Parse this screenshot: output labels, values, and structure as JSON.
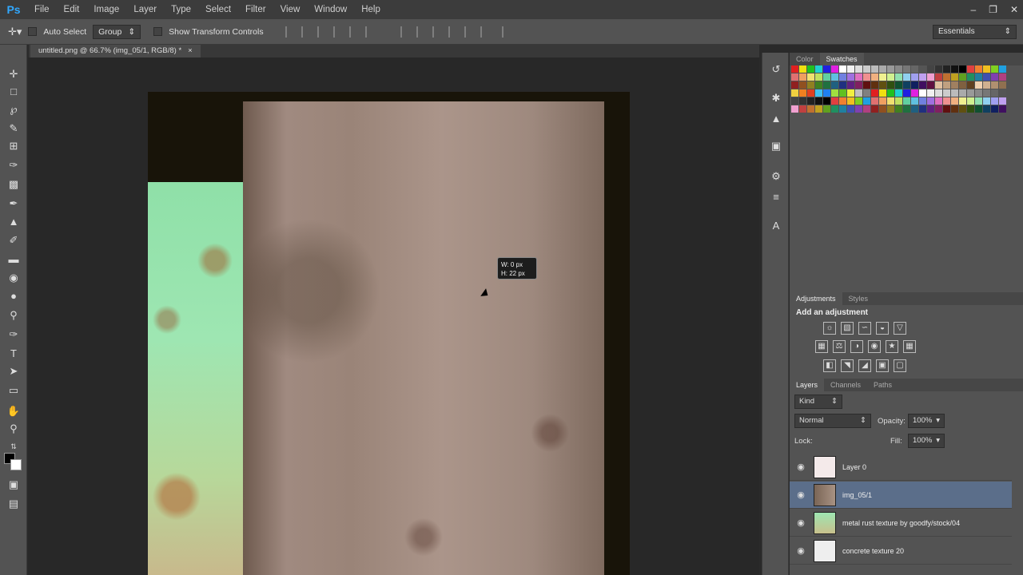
{
  "app": {
    "logo": "Ps"
  },
  "menu": [
    "File",
    "Edit",
    "Image",
    "Layer",
    "Type",
    "Select",
    "Filter",
    "View",
    "Window",
    "Help"
  ],
  "window_controls": [
    "minimize-icon",
    "restore-icon",
    "close-icon"
  ],
  "options": {
    "tool_icon": "move-tool-icon",
    "auto_select_label": "Auto Select",
    "auto_select_value": "Group",
    "show_transform_label": "Show Transform Controls",
    "workspace": "Essentials"
  },
  "document": {
    "tab_title": "untitled.png @ 66.7% (img_05/1, RGB/8) *",
    "tooltip_line1": "W: 0 px",
    "tooltip_line2": "H: 22 px"
  },
  "tools": [
    "move-tool-icon",
    "marquee-tool-icon",
    "lasso-tool-icon",
    "quick-select-tool-icon",
    "crop-tool-icon",
    "eyedropper-tool-icon",
    "healing-brush-icon",
    "brush-tool-icon",
    "clone-stamp-icon",
    "history-brush-icon",
    "eraser-tool-icon",
    "gradient-tool-icon",
    "blur-tool-icon",
    "dodge-tool-icon",
    "pen-tool-icon",
    "type-tool-icon",
    "path-select-tool-icon",
    "rectangle-tool-icon",
    "hand-tool-icon",
    "zoom-tool-icon"
  ],
  "strip_icons": [
    "history-icon",
    "brush-presets-icon",
    "clone-source-icon",
    "tool-presets-icon",
    "properties-icon",
    "character-icon"
  ],
  "swatches_panel": {
    "tabs": [
      "Color",
      "Swatches"
    ],
    "active": "Swatches"
  },
  "adjustments_panel": {
    "tabs": [
      "Adjustments",
      "Styles"
    ],
    "title": "Add an adjustment"
  },
  "layers_panel": {
    "tabs": [
      "Layers",
      "Channels",
      "Paths"
    ],
    "kind_filter": "Kind",
    "blend_mode": "Normal",
    "opacity_label": "Opacity:",
    "opacity_value": "100%",
    "lock_label": "Lock:",
    "fill_label": "Fill:",
    "fill_value": "100%",
    "layers": [
      {
        "name": "Layer 0",
        "selected": false
      },
      {
        "name": "img_05/1",
        "selected": true
      },
      {
        "name": "metal rust texture by goodfy/stock/04",
        "selected": false
      },
      {
        "name": "concrete texture 20",
        "selected": false
      }
    ]
  },
  "colors": {
    "accent": "#31a8ff",
    "selected_layer": "#5b6e8a"
  }
}
